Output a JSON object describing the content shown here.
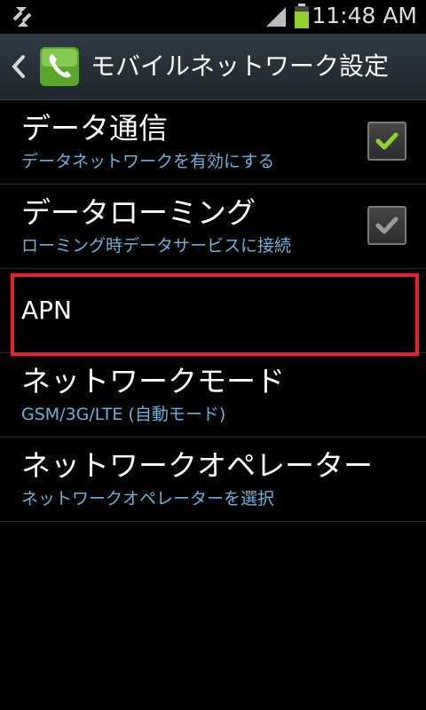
{
  "status_bar": {
    "time": "11:48 AM",
    "icons": [
      "sync-icon",
      "signal-icon",
      "battery-icon"
    ]
  },
  "action_bar": {
    "title": "モバイルネットワーク設定",
    "icons": [
      "back-icon",
      "phone-app-icon"
    ]
  },
  "settings": {
    "items": [
      {
        "title": "データ通信",
        "summary": "データネットワークを有効にする",
        "checked": true,
        "check_color": "#8fd12b"
      },
      {
        "title": "データローミング",
        "summary": "ローミング時データサービスに接続",
        "checked": true,
        "check_color": "#9a9a9a"
      },
      {
        "title": "APN",
        "highlighted": true
      },
      {
        "title": "ネットワークモード",
        "summary": "GSM/3G/LTE (自動モード)"
      },
      {
        "title": "ネットワークオペレーター",
        "summary": "ネットワークオペレーターを選択"
      }
    ]
  },
  "colors": {
    "background": "#000000",
    "summary_text": "#6cb1d9",
    "highlight": "#e8212b",
    "battery": "#8fd12b"
  }
}
